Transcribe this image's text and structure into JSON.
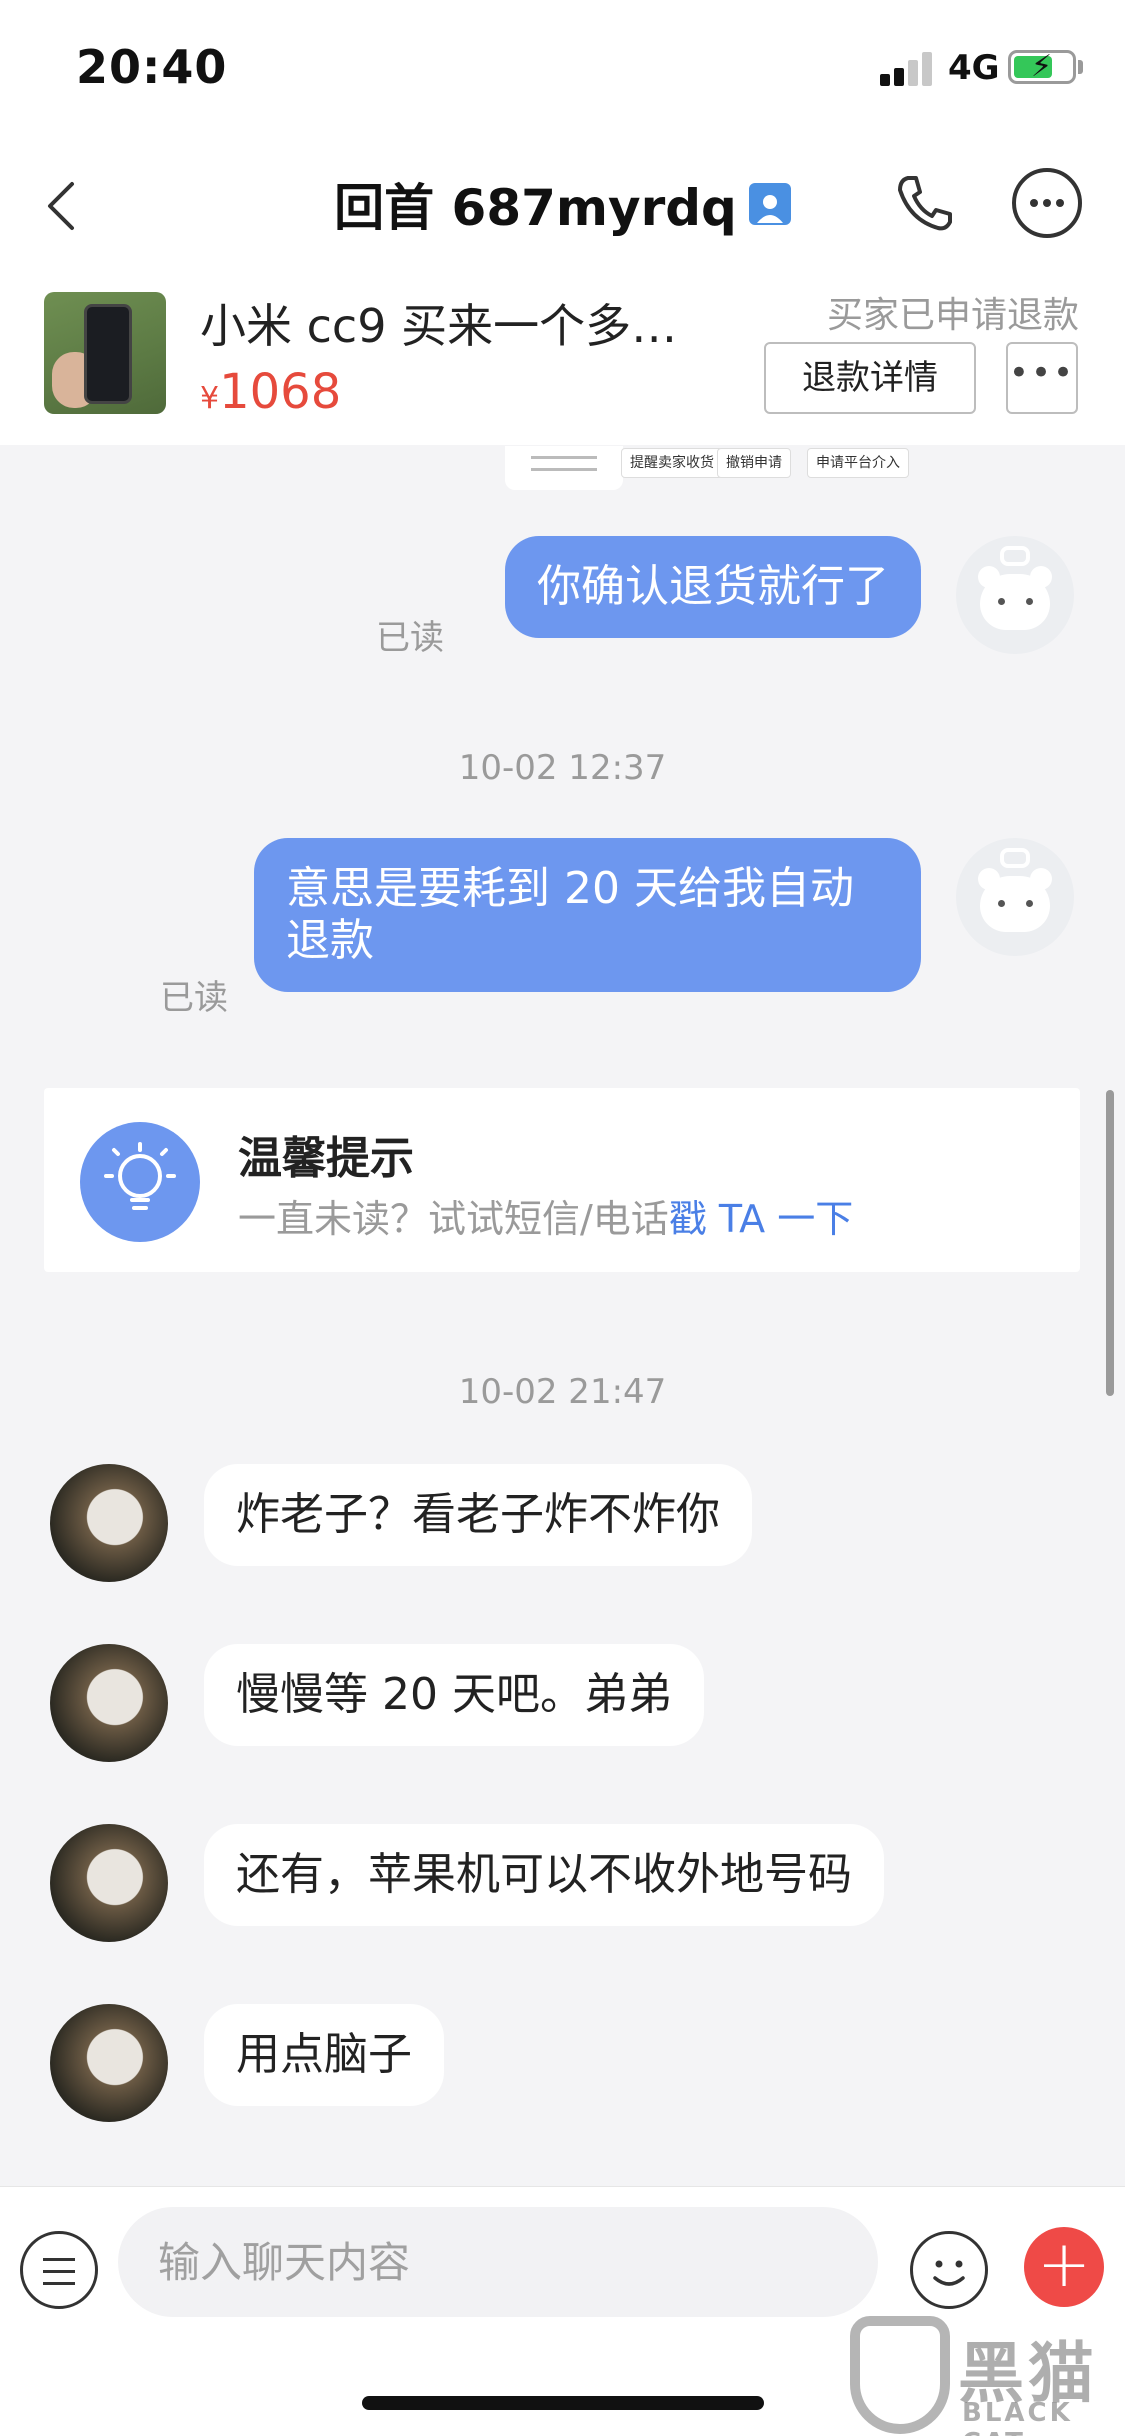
{
  "status_bar": {
    "time": "20:40",
    "network": "4G"
  },
  "nav": {
    "title": "回首 687myrdq"
  },
  "product": {
    "title": "小米 cc9 买来一个多…",
    "currency": "¥",
    "price": "1068",
    "status": "买家已申请退款",
    "detail_button": "退款详情",
    "more_button": "•••"
  },
  "mini_toolbar": {
    "chips": [
      "提醒卖家收货",
      "撤销申请",
      "申请平台介入"
    ]
  },
  "messages": [
    {
      "side": "me",
      "text": "你确认退货就行了",
      "read": "已读"
    },
    {
      "timestamp": "10-02 12:37"
    },
    {
      "side": "me",
      "text": "意思是要耗到 20 天给我自动退款",
      "read": "已读"
    },
    {
      "tip": true
    },
    {
      "timestamp": "10-02 21:47"
    },
    {
      "side": "other",
      "text": "炸老子？看老子炸不炸你"
    },
    {
      "side": "other",
      "text": "慢慢等 20 天吧。弟弟"
    },
    {
      "side": "other",
      "text": "还有，苹果机可以不收外地号码"
    },
    {
      "side": "other",
      "text": "用点脑子"
    }
  ],
  "tip": {
    "title": "温馨提示",
    "body_prefix": "一直未读？试试短信/电话",
    "body_link": "戳 TA 一下"
  },
  "input": {
    "placeholder": "输入聊天内容"
  },
  "watermark": {
    "main": "黑猫",
    "sub": "BLACK CAT"
  },
  "colors": {
    "my_bubble": "#6d97ef",
    "price": "#e64a3c",
    "add_button": "#ef4a47",
    "link": "#4a7fe6"
  }
}
